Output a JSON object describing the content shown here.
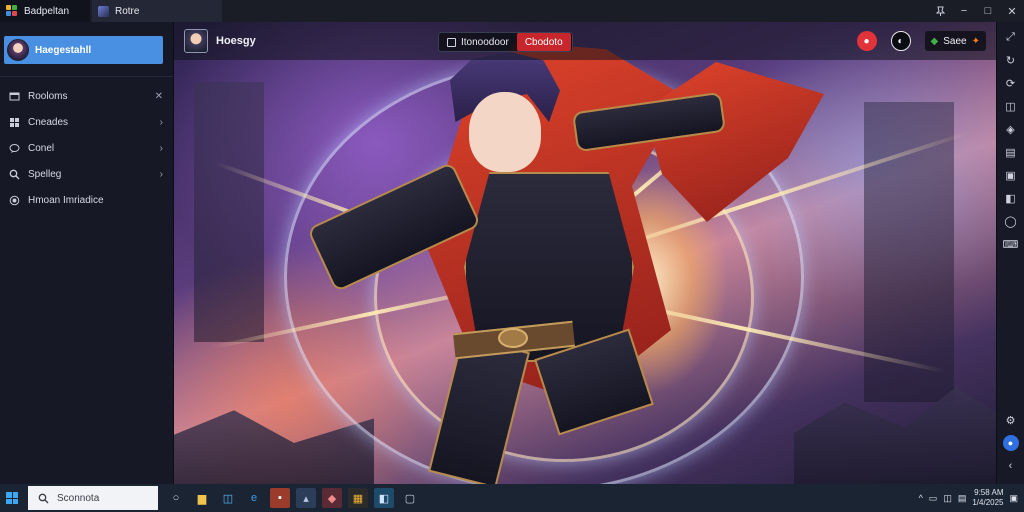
{
  "titlebar": {
    "tabs": [
      {
        "label": "Badpeltan"
      },
      {
        "label": "Rotre"
      }
    ],
    "controls": {
      "pin": "pin-icon",
      "minimize": "−",
      "maximize": "□",
      "close": "✕"
    }
  },
  "sidebar": {
    "profile_name": "Haegestahll",
    "items": [
      {
        "label": "Rooloms",
        "icon": "window-icon"
      },
      {
        "label": "Cneades",
        "icon": "grid-icon"
      },
      {
        "label": "Conel",
        "icon": "chat-icon"
      },
      {
        "label": "Spelleg",
        "icon": "search-icon"
      },
      {
        "label": "Hmoan Imriadice",
        "icon": "record-icon"
      }
    ]
  },
  "game": {
    "player_name": "Hoesgy",
    "field_text": "Itonoodoor",
    "button_label": "Cbodoto",
    "pill_label": "Saee",
    "accent_red": "#c8262d"
  },
  "taskbar": {
    "search_placeholder": "Sconnota",
    "clock_line1": "9:58 AM",
    "clock_line2": "1/4/2025"
  }
}
